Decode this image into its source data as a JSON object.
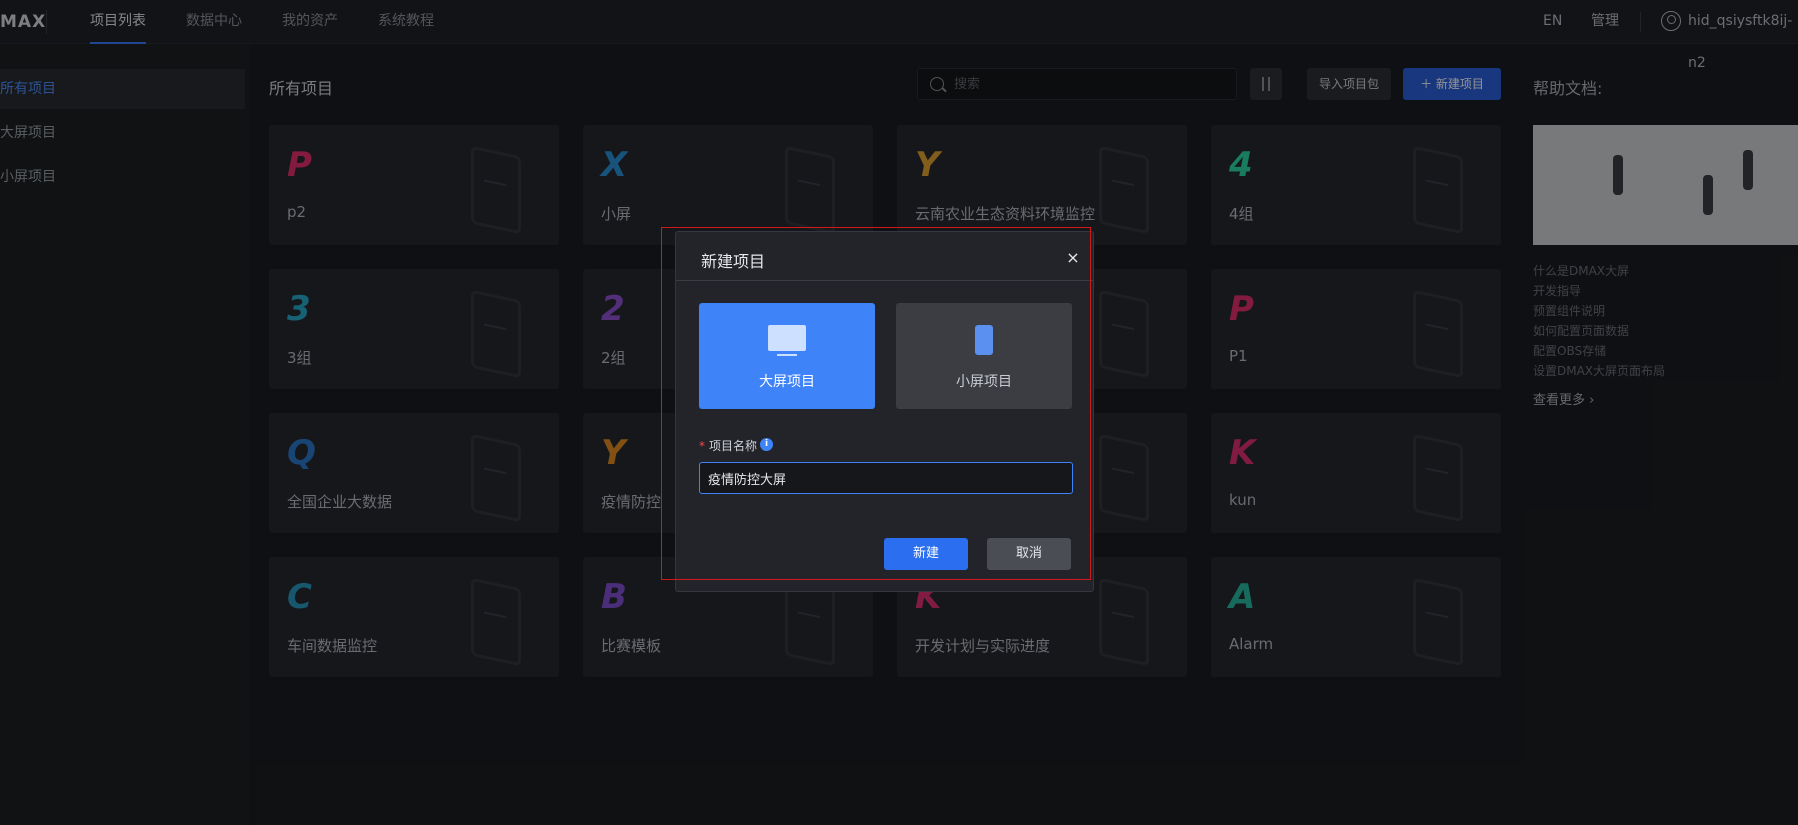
{
  "app": {
    "logo": "MAX"
  },
  "nav": {
    "items": [
      {
        "label": "项目列表",
        "active": true
      },
      {
        "label": "数据中心"
      },
      {
        "label": "我的资产"
      },
      {
        "label": "系统教程"
      }
    ],
    "lang": "EN",
    "admin": "管理",
    "user": "hid_qsiysftk8ij-n2"
  },
  "sidebar": {
    "items": [
      {
        "label": "所有项目",
        "active": true
      },
      {
        "label": "大屏项目"
      },
      {
        "label": "小屏项目"
      }
    ]
  },
  "main": {
    "title": "所有项目",
    "search_placeholder": "搜索",
    "import_label": "导入项目包",
    "new_label": "＋ 新建项目",
    "projects": [
      {
        "name": "p2",
        "glyph": "P",
        "color": "#e0306a"
      },
      {
        "name": "小屏",
        "glyph": "X",
        "color": "#2a8fd6"
      },
      {
        "name": "云南农业生态资料环境监控",
        "glyph": "Y",
        "color": "#e0a030"
      },
      {
        "name": "4组",
        "glyph": "4",
        "color": "#2ad6a0"
      },
      {
        "name": "3组",
        "glyph": "3",
        "color": "#28a8c8"
      },
      {
        "name": "2组",
        "glyph": "2",
        "color": "#9050d0"
      },
      {
        "name": "",
        "glyph": "",
        "color": "#444"
      },
      {
        "name": "P1",
        "glyph": "P",
        "color": "#e0306a"
      },
      {
        "name": "全国企业大数据",
        "glyph": "Q",
        "color": "#2a78c8"
      },
      {
        "name": "疫情防控",
        "glyph": "Y",
        "color": "#e08a20"
      },
      {
        "name": "",
        "glyph": "",
        "color": "#444"
      },
      {
        "name": "kun",
        "glyph": "K",
        "color": "#e03070"
      },
      {
        "name": "车间数据监控",
        "glyph": "C",
        "color": "#2a98c0"
      },
      {
        "name": "比赛模板",
        "glyph": "B",
        "color": "#8050d0"
      },
      {
        "name": "开发计划与实际进度",
        "glyph": "K",
        "color": "#e03070"
      },
      {
        "name": "Alarm",
        "glyph": "A",
        "color": "#28b8a0"
      }
    ]
  },
  "help": {
    "title": "帮助文档:",
    "links": [
      "什么是DMAX大屏",
      "开发指导",
      "预置组件说明",
      "如何配置页面数据",
      "配置OBS存储",
      "设置DMAX大屏页面布局"
    ],
    "more": "查看更多 ›"
  },
  "modal": {
    "title": "新建项目",
    "close": "×",
    "type_big": "大屏项目",
    "type_small": "小屏项目",
    "field_label": "项目名称",
    "field_value": "疫情防控大屏",
    "create": "新建",
    "cancel": "取消"
  },
  "colors": {
    "accent": "#3f83f8",
    "highlight": "#d01a1a"
  }
}
